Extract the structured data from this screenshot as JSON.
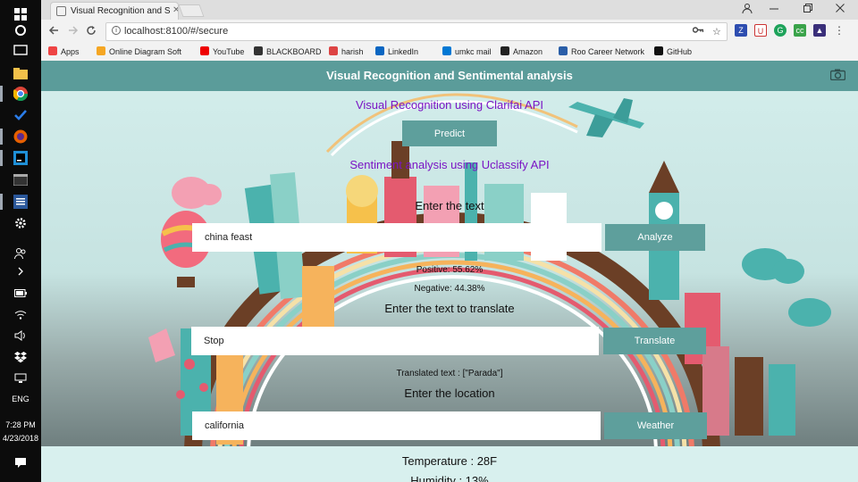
{
  "taskbar": {
    "time": "7:28 PM",
    "date": "4/23/2018",
    "lang": "ENG"
  },
  "browser": {
    "tab_title": "Visual Recognition and S",
    "url": "localhost:8100/#/secure",
    "bookmarks": [
      {
        "label": "Apps",
        "icon": "apps-grid-icon",
        "color": "#e44"
      },
      {
        "label": "Online Diagram Soft",
        "icon": "diagram-icon",
        "color": "#f5a623"
      },
      {
        "label": "YouTube",
        "icon": "youtube-icon",
        "color": "#e00"
      },
      {
        "label": "BLACKBOARD",
        "icon": "blackboard-icon",
        "color": "#333"
      },
      {
        "label": "harish",
        "icon": "gmail-icon",
        "color": "#d44"
      },
      {
        "label": "LinkedIn",
        "icon": "linkedin-icon",
        "color": "#0a66c2"
      },
      {
        "label": "umkc mail",
        "icon": "mail-icon",
        "color": "#0078d4"
      },
      {
        "label": "Amazon",
        "icon": "amazon-icon",
        "color": "#222"
      },
      {
        "label": "Roo Career Network",
        "icon": "roo-icon",
        "color": "#2a5ea8"
      },
      {
        "label": "GitHub",
        "icon": "github-icon",
        "color": "#111"
      }
    ]
  },
  "app": {
    "header_title": "Visual Recognition and Sentimental analysis",
    "clarifai_heading": "Visual Recognition using Clarifai API",
    "predict_label": "Predict",
    "uclassify_heading": "Sentiment analysis using Uclassify API",
    "enter_text_label": "Enter the text",
    "sentiment_input_value": "china feast",
    "analyze_label": "Analyze",
    "positive_text": "Positive: 55.62%",
    "negative_text": "Negative: 44.38%",
    "translate_heading": "Enter the text to translate",
    "translate_input_value": "Stop",
    "translate_label": "Translate",
    "translated_text": "Translated text : [\"Parada\"]",
    "location_heading": "Enter the location",
    "location_input_value": "california",
    "weather_label": "Weather",
    "temperature_text": "Temperature : 28F",
    "humidity_text": "Humidity : 13%"
  },
  "colors": {
    "header": "#5b9c9a",
    "button": "#5e9f9c",
    "heading_purple": "#7a14c4"
  }
}
